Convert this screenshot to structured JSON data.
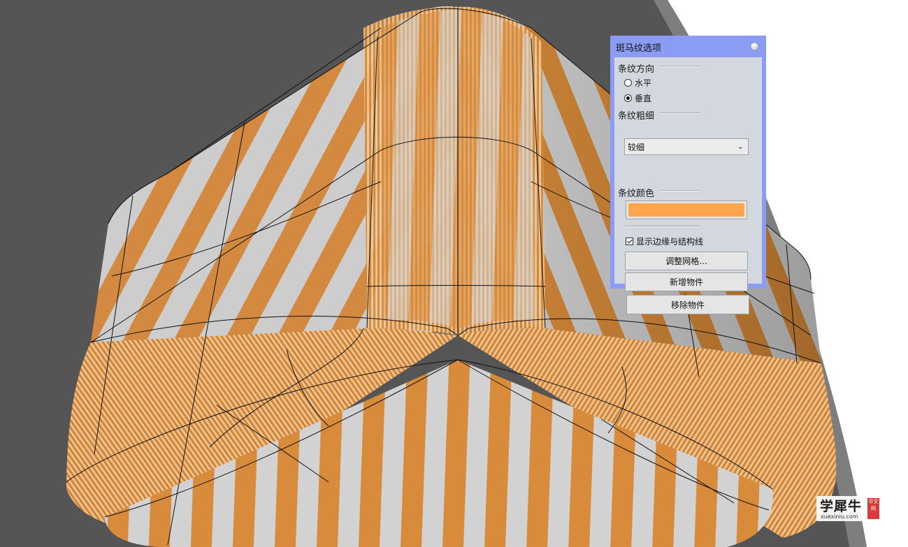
{
  "dialog": {
    "title": "斑马纹选项",
    "direction": {
      "label": "条纹方向",
      "options": [
        "水平",
        "垂直"
      ],
      "selected": "垂直"
    },
    "thickness": {
      "label": "条纹粗细",
      "value": "较细"
    },
    "stripe_color": {
      "label": "条纹颜色",
      "value": "#ffa64d"
    },
    "show_edges": {
      "label": "显示边缘与结构线",
      "checked": true
    },
    "buttons": {
      "adjust_mesh": "调整网格...",
      "add_object": "新增物件",
      "remove_object": "移除物件"
    }
  },
  "watermark": {
    "name": "学犀牛",
    "url": "xuexiniu.com",
    "badge": "中文网"
  },
  "colors": {
    "background": "#555555",
    "dialog_frame": "#8b9df3",
    "dialog_body": "#d3d8de",
    "stripe_orange": "#d4893d",
    "stripe_light": "#cfcfcf"
  }
}
